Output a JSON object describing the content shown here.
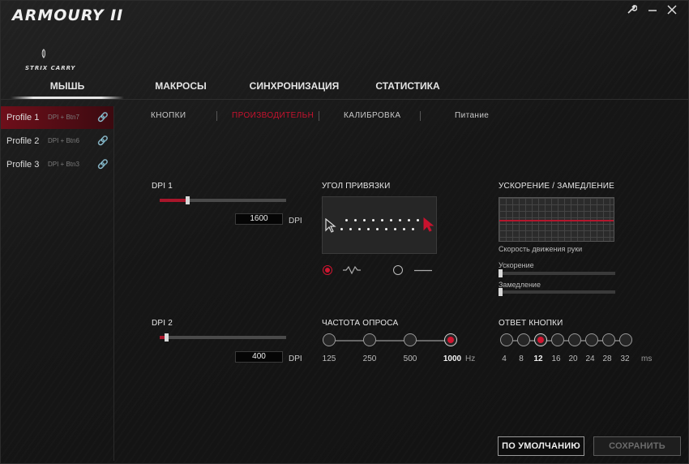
{
  "app": {
    "title": "ARMOURY II",
    "device_name": "STRIX CARRY",
    "window_controls": {
      "settings_icon": "wrench-icon",
      "minimize_icon": "minus-icon",
      "close_icon": "close-icon"
    }
  },
  "main_tabs": [
    {
      "label": "МЫШЬ",
      "active": true
    },
    {
      "label": "МАКРОСЫ",
      "active": false
    },
    {
      "label": "СИНХРОНИЗАЦИЯ",
      "active": false
    },
    {
      "label": "СТАТИСТИКА",
      "active": false
    }
  ],
  "profiles": [
    {
      "name": "Profile 1",
      "button": "DPI + Btn7",
      "active": true
    },
    {
      "name": "Profile 2",
      "button": "DPI + Btn6",
      "active": false
    },
    {
      "name": "Profile 3",
      "button": "DPI + Btn3",
      "active": false
    }
  ],
  "sub_tabs": [
    {
      "label": "КНОПКИ",
      "active": false
    },
    {
      "label": "ПРОИЗВОДИТЕЛЬН",
      "active": true
    },
    {
      "label": "КАЛИБРОВКА",
      "active": false
    },
    {
      "label": "Питание",
      "active": false
    }
  ],
  "dpi1": {
    "label": "DPI 1",
    "value": "1600",
    "unit": "DPI",
    "level": 0.22
  },
  "dpi2": {
    "label": "DPI 2",
    "value": "400",
    "unit": "DPI",
    "level": 0.05
  },
  "angle_snapping": {
    "label": "УГОЛ ПРИВЯЗКИ",
    "on_selected": true
  },
  "acceleration": {
    "label": "УСКОРЕНИЕ / ЗАМЕДЛЕНИЕ",
    "graph_caption": "Скорость движения руки",
    "accel_label": "Ускорение",
    "decel_label": "Замедление",
    "accel_level": 0.0,
    "decel_level": 0.0
  },
  "polling_rate": {
    "label": "ЧАСТОТА ОПРОСА",
    "options": [
      "125",
      "250",
      "500",
      "1000"
    ],
    "selected_index": 3,
    "unit": "Hz"
  },
  "button_response": {
    "label": "ОТВЕТ КНОПКИ",
    "options": [
      "4",
      "8",
      "12",
      "16",
      "20",
      "24",
      "28",
      "32"
    ],
    "selected_index": 2,
    "unit": "ms"
  },
  "footer": {
    "default_label": "ПО УМОЛЧАНИЮ",
    "save_label": "СОХРАНИТЬ"
  },
  "colors": {
    "accent": "#d01530",
    "background": "#161616"
  }
}
